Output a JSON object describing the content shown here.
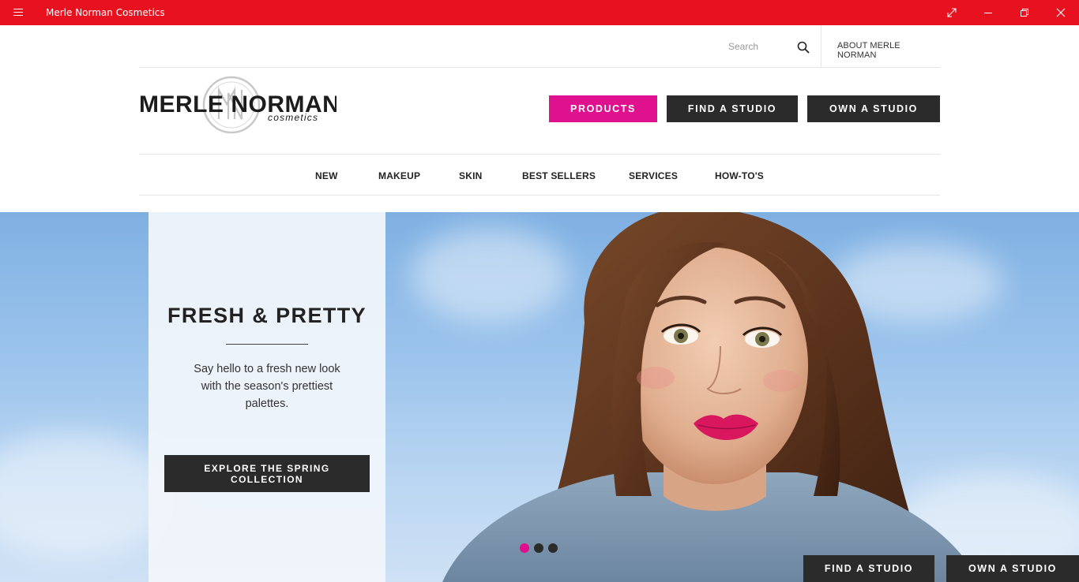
{
  "window": {
    "title": "Merle Norman Cosmetics",
    "accent_color": "#e8111f"
  },
  "header": {
    "search_placeholder": "Search",
    "about_label": "ABOUT MERLE NORMAN",
    "logo": {
      "brand": "MERLE NORMAN",
      "tagline": "cosmetics",
      "monogram": "MN"
    },
    "buttons": {
      "products": "PRODUCTS",
      "find_studio": "FIND A STUDIO",
      "own_studio": "OWN A STUDIO"
    },
    "brand_pink": "#e0118f"
  },
  "nav": {
    "items": [
      "NEW",
      "MAKEUP",
      "SKIN",
      "BEST SELLERS",
      "SERVICES",
      "HOW-TO'S"
    ]
  },
  "hero": {
    "title": "FRESH & PRETTY",
    "text": "Say hello to a fresh new look with the season's prettiest palettes.",
    "cta": "EXPLORE THE SPRING COLLECTION",
    "carousel": {
      "slides": 3,
      "active_slide": 1,
      "active_color": "#e0118f"
    }
  },
  "footer_buttons": {
    "find_studio": "FIND A STUDIO",
    "own_studio": "OWN A STUDIO"
  },
  "icons": [
    "hamburger-menu-icon",
    "fullscreen-icon",
    "minimize-icon",
    "restore-icon",
    "close-icon",
    "search-icon"
  ]
}
